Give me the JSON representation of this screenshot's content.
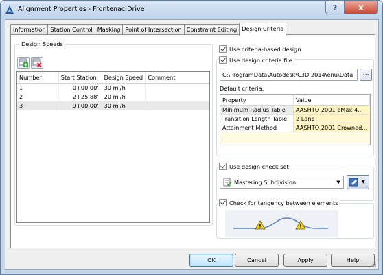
{
  "window": {
    "title": "Alignment Properties - Frontenac Drive",
    "help_glyph": "?",
    "close_glyph": "x"
  },
  "tabs": [
    {
      "label": "Information"
    },
    {
      "label": "Station Control"
    },
    {
      "label": "Masking"
    },
    {
      "label": "Point of Intersection"
    },
    {
      "label": "Constraint Editing"
    },
    {
      "label": "Design Criteria",
      "active": true
    }
  ],
  "design_speeds": {
    "group_title": "Design Speeds",
    "columns": [
      "Number",
      "Start Station",
      "Design Speed",
      "Comment"
    ],
    "rows": [
      {
        "number": "1",
        "station": "0+00.00'",
        "speed": "30 mi/h",
        "comment": ""
      },
      {
        "number": "2",
        "station": "2+25.88'",
        "speed": "20 mi/h",
        "comment": ""
      },
      {
        "number": "3",
        "station": "9+00.00'",
        "speed": "30 mi/h",
        "comment": ""
      }
    ]
  },
  "criteria": {
    "use_criteria_label": "Use criteria-based design",
    "use_file_label": "Use design criteria file",
    "file_path": "C:\\ProgramData\\Autodesk\\C3D 2014\\enu\\Data",
    "browse_label": "...",
    "default_criteria_label": "Default criteria:",
    "prop_columns": [
      "Property",
      "Value"
    ],
    "prop_rows": [
      {
        "property": "Minimum Radius Table",
        "value": "AASHTO 2001 eMax 4..."
      },
      {
        "property": "Transition Length Table",
        "value": "2 Lane"
      },
      {
        "property": "Attainment Method",
        "value": "AASHTO 2001 Crowned..."
      }
    ]
  },
  "check_set": {
    "use_label": "Use design check set",
    "selected": "Mastering Subdivision"
  },
  "tangency": {
    "label": "Check for tangency between elements"
  },
  "buttons": {
    "ok": "OK",
    "cancel": "Cancel",
    "apply": "Apply",
    "help": "Help"
  },
  "colors": {
    "warning": "#f2d21b",
    "curve": "#5a86c8",
    "accent": "#3c7fb1"
  }
}
